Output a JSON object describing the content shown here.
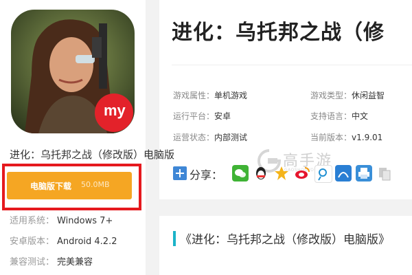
{
  "app": {
    "title": "进化：乌托邦之战（修改版）电脑版",
    "icon_badge": "my",
    "download_button": {
      "label": "电脑版下载",
      "size": "50.0MB"
    },
    "specs": [
      {
        "key": "适用系统：",
        "value": "Windows 7+"
      },
      {
        "key": "安卓版本：",
        "value": "Android 4.2.2"
      },
      {
        "key": "兼容测试：",
        "value": "完美兼容"
      }
    ]
  },
  "detail": {
    "title": "进化：乌托邦之战（修",
    "attributes": [
      {
        "key": "游戏属性：",
        "value": "单机游戏"
      },
      {
        "key": "游戏类型：",
        "value": "休闲益智"
      },
      {
        "key": "运行平台：",
        "value": "安卓"
      },
      {
        "key": "支持语言：",
        "value": "中文"
      },
      {
        "key": "运营状态：",
        "value": "内部测试"
      },
      {
        "key": "当前版本：",
        "value": "v1.9.01"
      }
    ],
    "share_label": "分享：",
    "share_icons": [
      "wechat-icon",
      "qq-icon",
      "qzone-icon",
      "weibo-icon",
      "tencent-weibo-icon",
      "renren-icon",
      "print-icon",
      "copy-icon"
    ]
  },
  "watermark": {
    "text": "高手游",
    "sub": "GAOSHOUYOU.COM"
  },
  "article": {
    "title": "《进化：乌托邦之战（修改版）电脑版》"
  },
  "colors": {
    "download": "#f5a623",
    "highlight_frame": "#e5191e",
    "accent_bar": "#1bb3c8"
  }
}
